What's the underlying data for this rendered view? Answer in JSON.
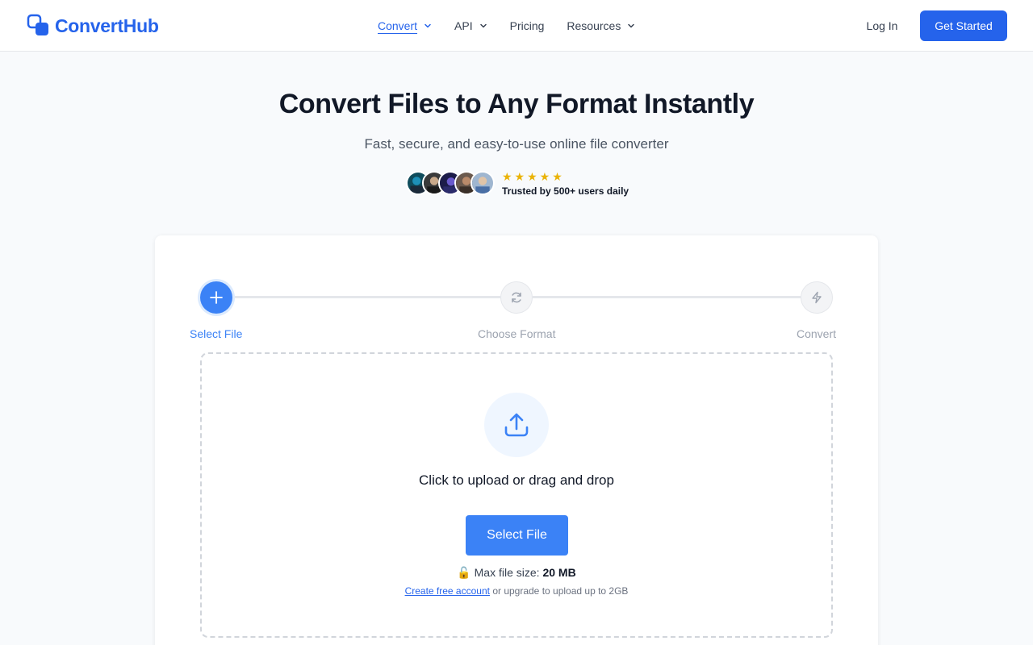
{
  "brand": {
    "name": "ConvertHub",
    "color": "#2563eb"
  },
  "nav": {
    "items": [
      {
        "label": "Convert",
        "dropdown": true,
        "active": true
      },
      {
        "label": "API",
        "dropdown": true
      },
      {
        "label": "Pricing",
        "dropdown": false
      },
      {
        "label": "Resources",
        "dropdown": true
      }
    ],
    "login_label": "Log In",
    "cta_label": "Get Started"
  },
  "hero": {
    "title": "Convert Files to Any Format Instantly",
    "subtitle": "Fast, secure, and easy-to-use online file converter",
    "rating_stars": "★★★★★",
    "rating": 5,
    "trust_text": "Trusted by 500+ users daily"
  },
  "steps": [
    {
      "label": "Select File",
      "icon": "plus-icon",
      "active": true
    },
    {
      "label": "Choose Format",
      "icon": "refresh-icon",
      "active": false
    },
    {
      "label": "Convert",
      "icon": "lightning-icon",
      "active": false
    }
  ],
  "upload": {
    "icon": "upload-icon",
    "prompt": "Click to upload or drag and drop",
    "button_label": "Select File",
    "max_size_prefix": "Max file size:",
    "max_size_value": "20 MB",
    "lock_icon": "🔓",
    "create_account_link": "Create free account",
    "upgrade_text": "or upgrade to upload up to 2GB"
  },
  "colors": {
    "primary": "#3b82f6",
    "star": "#eab308"
  }
}
